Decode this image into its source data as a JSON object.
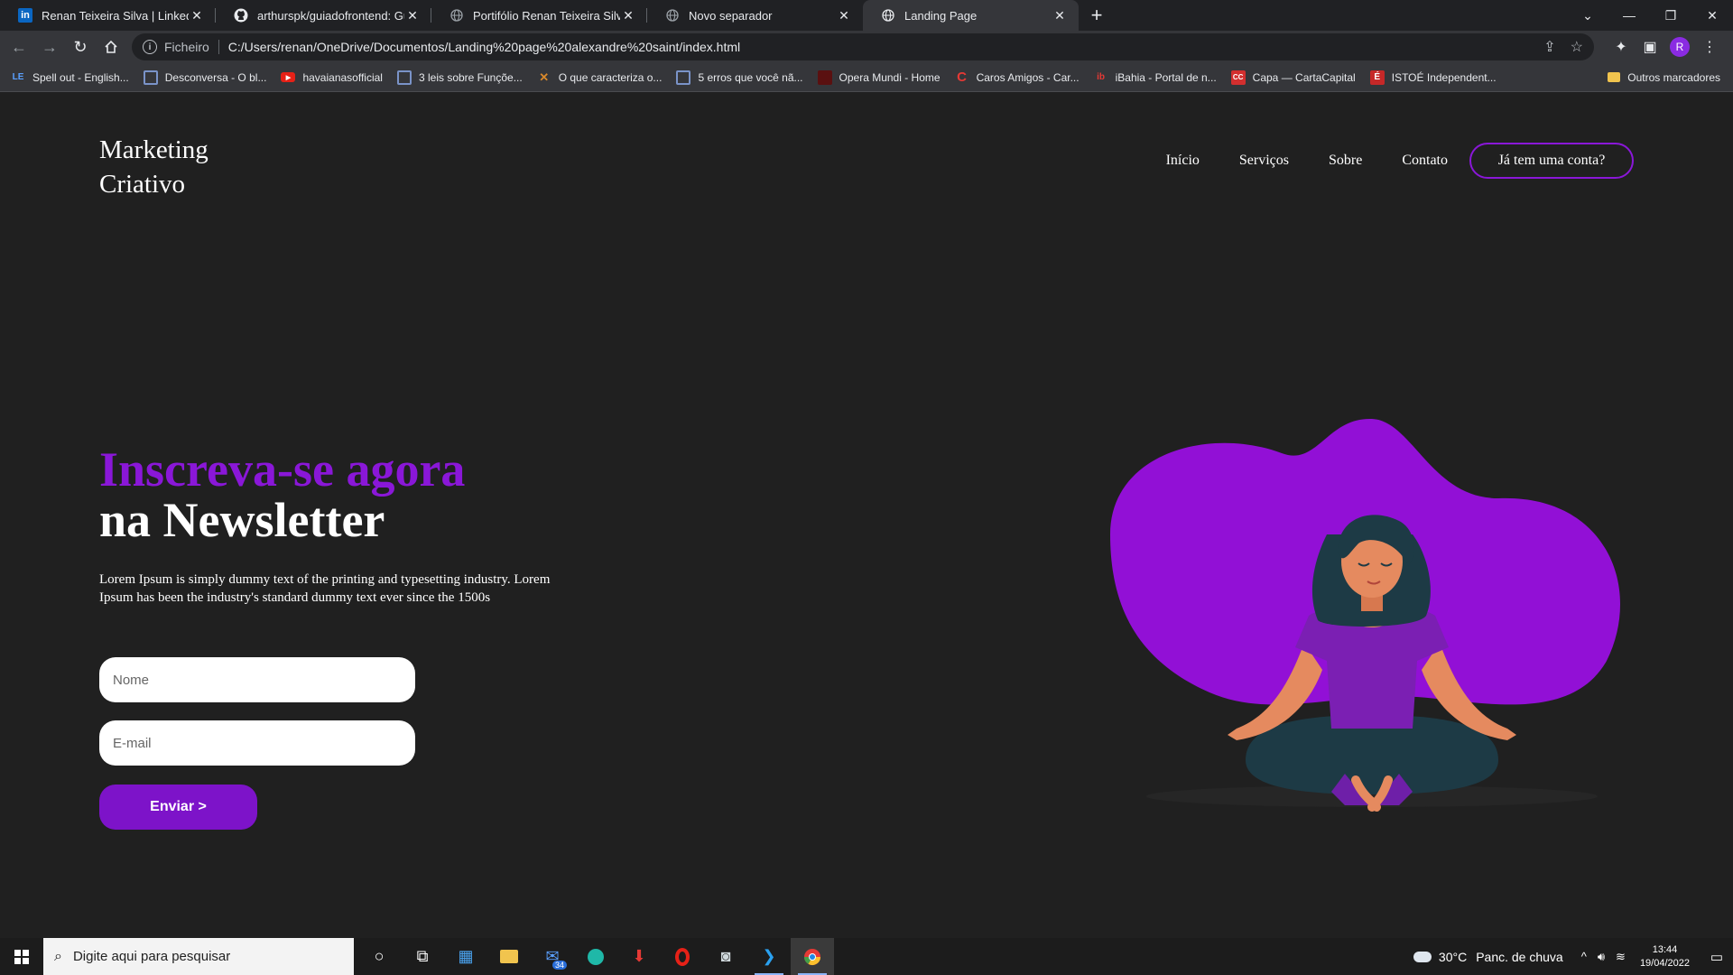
{
  "browser": {
    "tabs": [
      {
        "title": "Renan Teixeira Silva | LinkedIn",
        "favicon": "in",
        "active": false
      },
      {
        "title": "arthurspk/guiadofrontend: Guia d",
        "favicon": "github",
        "active": false
      },
      {
        "title": "Portifólio Renan Teixeira Silva",
        "favicon": "globe",
        "active": false
      },
      {
        "title": "Novo separador",
        "favicon": "globe",
        "active": false
      },
      {
        "title": "Landing Page",
        "favicon": "globe",
        "active": true
      }
    ],
    "address": {
      "scheme_label": "Ficheiro",
      "url": "C:/Users/renan/OneDrive/Documentos/Landing%20page%20alexandre%20saint/index.html"
    },
    "profile_initial": "R",
    "bookmarks": [
      {
        "label": "Spell out - English...",
        "icon": "LE",
        "color": "#3b82f6"
      },
      {
        "label": "Desconversa - O bl...",
        "icon": "grid",
        "color": "#4f6fb0"
      },
      {
        "label": "havaianasofficial",
        "icon": "▶",
        "color": "#e62117"
      },
      {
        "label": "3 leis sobre Funçõe...",
        "icon": "grid",
        "color": "#4f6fb0"
      },
      {
        "label": "O que caracteriza o...",
        "icon": "✕",
        "color": "#d9892b"
      },
      {
        "label": "5 erros que você nã...",
        "icon": "grid",
        "color": "#4f6fb0"
      },
      {
        "label": "Opera Mundi - Home",
        "icon": "■",
        "color": "#8b1a1a"
      },
      {
        "label": "Caros Amigos - Car...",
        "icon": "C",
        "color": "#e53935"
      },
      {
        "label": "iBahia - Portal de n...",
        "icon": "ib",
        "color": "#e53935"
      },
      {
        "label": "Capa — CartaCapital",
        "icon": "CC",
        "color": "#d32f2f"
      },
      {
        "label": "ISTOÉ Independent...",
        "icon": "É",
        "color": "#c62828"
      }
    ],
    "bookmarks_other": "Outros marcadores"
  },
  "page": {
    "brand_line1": "Marketing",
    "brand_line2": "Criativo",
    "nav": [
      {
        "label": "Início"
      },
      {
        "label": "Serviços"
      },
      {
        "label": "Sobre"
      },
      {
        "label": "Contato"
      }
    ],
    "account_button": "Já tem uma conta?",
    "headline_accent": "Inscreva-se agora",
    "headline_main": "na Newsletter",
    "description": "Lorem Ipsum is simply dummy text of the printing and typesetting industry. Lorem Ipsum has been the industry's standard dummy text ever since the 1500s",
    "name_placeholder": "Nome",
    "email_placeholder": "E-mail",
    "submit_label": "Enviar >",
    "accent_color": "#8a17d8"
  },
  "taskbar": {
    "search_placeholder": "Digite aqui para pesquisar",
    "mail_badge": "34",
    "temperature": "30°C",
    "weather_text": "Panc. de chuva",
    "time": "13:44",
    "date": "19/04/2022"
  }
}
